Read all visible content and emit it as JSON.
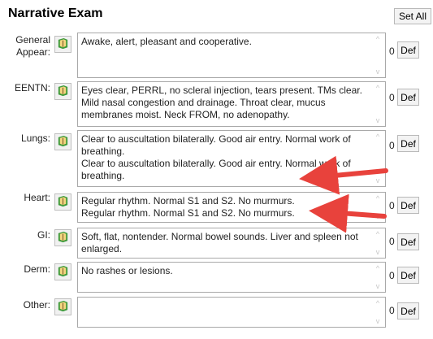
{
  "header": {
    "title": "Narrative Exam",
    "set_all_label": "Set All"
  },
  "sections": [
    {
      "label": "General\nAppear:",
      "text": "Awake, alert, pleasant and cooperative.",
      "count": "0",
      "def_label": "Def"
    },
    {
      "label": "EENTN:",
      "text": "Eyes clear, PERRL, no scleral injection, tears present.  TMs clear.  Mild nasal congestion and drainage.  Throat clear, mucus membranes moist.  Neck FROM, no adenopathy.",
      "count": "0",
      "def_label": "Def"
    },
    {
      "label": "Lungs:",
      "text": "Clear to auscultation bilaterally. Good air entry.  Normal work of breathing.\nClear to auscultation bilaterally. Good air entry.  Normal work of breathing.",
      "count": "0",
      "def_label": "Def"
    },
    {
      "label": "Heart:",
      "text": "Regular rhythm.  Normal S1 and S2.  No murmurs.\nRegular rhythm.  Normal S1 and S2.  No murmurs.",
      "count": "0",
      "def_label": "Def"
    },
    {
      "label": "GI:",
      "text": "Soft, flat, nontender.  Normal bowel sounds.  Liver and spleen not enlarged.",
      "count": "0",
      "def_label": "Def"
    },
    {
      "label": "Derm:",
      "text": "No rashes or lesions.",
      "count": "0",
      "def_label": "Def"
    },
    {
      "label": "Other:",
      "text": "",
      "count": "0",
      "def_label": "Def"
    }
  ],
  "icons": {
    "template_button": "book-icon",
    "scroll_up": "chevron-up-icon",
    "scroll_down": "chevron-down-icon"
  },
  "colors": {
    "annotation_arrow": "#e8423c",
    "icon_green": "#3d9a3a"
  }
}
